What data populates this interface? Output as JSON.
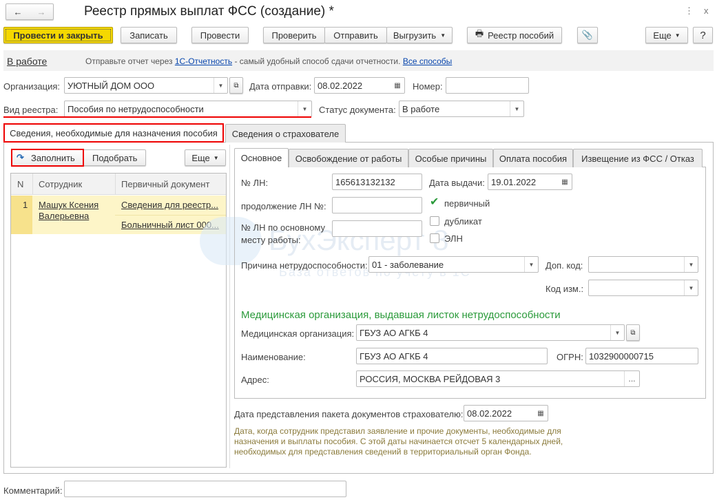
{
  "window": {
    "title": "Реестр прямых выплат ФСС (создание) *",
    "back_icon": "←",
    "forward_icon": "→",
    "menu_icon": "⋮",
    "close_icon": "x"
  },
  "toolbar": {
    "post_close": "Провести и закрыть",
    "save": "Записать",
    "post": "Провести",
    "check": "Проверить",
    "send": "Отправить",
    "export": "Выгрузить",
    "registry": "Реестр пособий",
    "more": "Еще",
    "help": "?"
  },
  "infobar": {
    "status": "В работе",
    "text1": "Отправьте отчет через",
    "link1": "1С-Отчетность",
    "text2": "- самый удобный способ сдачи отчетности.",
    "link2": "Все способы"
  },
  "header": {
    "org_label": "Организация:",
    "org_value": "УЮТНЫЙ ДОМ ООО",
    "send_date_label": "Дата отправки:",
    "send_date": "08.02.2022",
    "number_label": "Номер:",
    "number": "",
    "kind_label": "Вид реестра:",
    "kind_value": "Пособия по нетрудоспособности",
    "doc_status_label": "Статус документа:",
    "doc_status": "В работе"
  },
  "tabs": [
    "Сведения, необходимые для назначения пособия",
    "Сведения о страхователе"
  ],
  "left": {
    "fill": "Заполнить",
    "pick": "Подобрать",
    "more": "Еще",
    "columns": [
      "N",
      "Сотрудник",
      "Первичный документ"
    ],
    "rows": [
      {
        "n": "1",
        "employee": "Машук Ксения Валерьевна",
        "doc1": "Сведения для реестр...",
        "doc2": "Больничный лист 000..."
      }
    ]
  },
  "subtabs": [
    "Основное",
    "Освобождение от работы",
    "Особые причины",
    "Оплата пособия",
    "Извещение из ФСС / Отказ"
  ],
  "main": {
    "ln_label": "№ ЛН:",
    "ln": "165613132132",
    "issue_label": "Дата выдачи:",
    "issue": "19.01.2022",
    "cont_label": "продолжение ЛН №:",
    "cont": "",
    "primary": "первичный",
    "duplicate": "дубликат",
    "eln": "ЭЛН",
    "main_ln_label": "№ ЛН по основному месту работы:",
    "main_ln": "",
    "reason_label": "Причина нетрудоспособности:",
    "reason": "01 - заболевание",
    "extra_label": "Доп. код:",
    "extra": "",
    "change_label": "Код изм.:",
    "change": "",
    "med_header": "Медицинская организация, выдавшая листок нетрудоспособности",
    "med_label": "Медицинская организация:",
    "med": "ГБУЗ АО АГКБ 4",
    "name_label": "Наименование:",
    "name": "ГБУЗ АО АГКБ 4",
    "ogrn_label": "ОГРН:",
    "ogrn": "1032900000715",
    "addr_label": "Адрес:",
    "addr": "РОССИЯ, МОСКВА РЕЙДОВАЯ 3"
  },
  "package": {
    "label": "Дата представления пакета документов страхователю:",
    "date": "08.02.2022",
    "hint": "Дата, когда сотрудник представил заявление и прочие документы, необходимые для назначения и выплаты пособия. С этой даты начинается отсчет 5 календарных дней, необходимых для представления сведений в территориальный орган Фонда."
  },
  "comment": {
    "label": "Комментарий:",
    "value": ""
  },
  "watermark": {
    "brand": "БухЭксперт 8",
    "sub": "База ответов по учету в 1С"
  },
  "colors": {
    "accent_yellow": "#f5d800",
    "row_highlight": "#fdf5c8",
    "green_header": "#2a9a3a",
    "red_highlight": "#e00000",
    "hint": "#8a7a3a"
  }
}
